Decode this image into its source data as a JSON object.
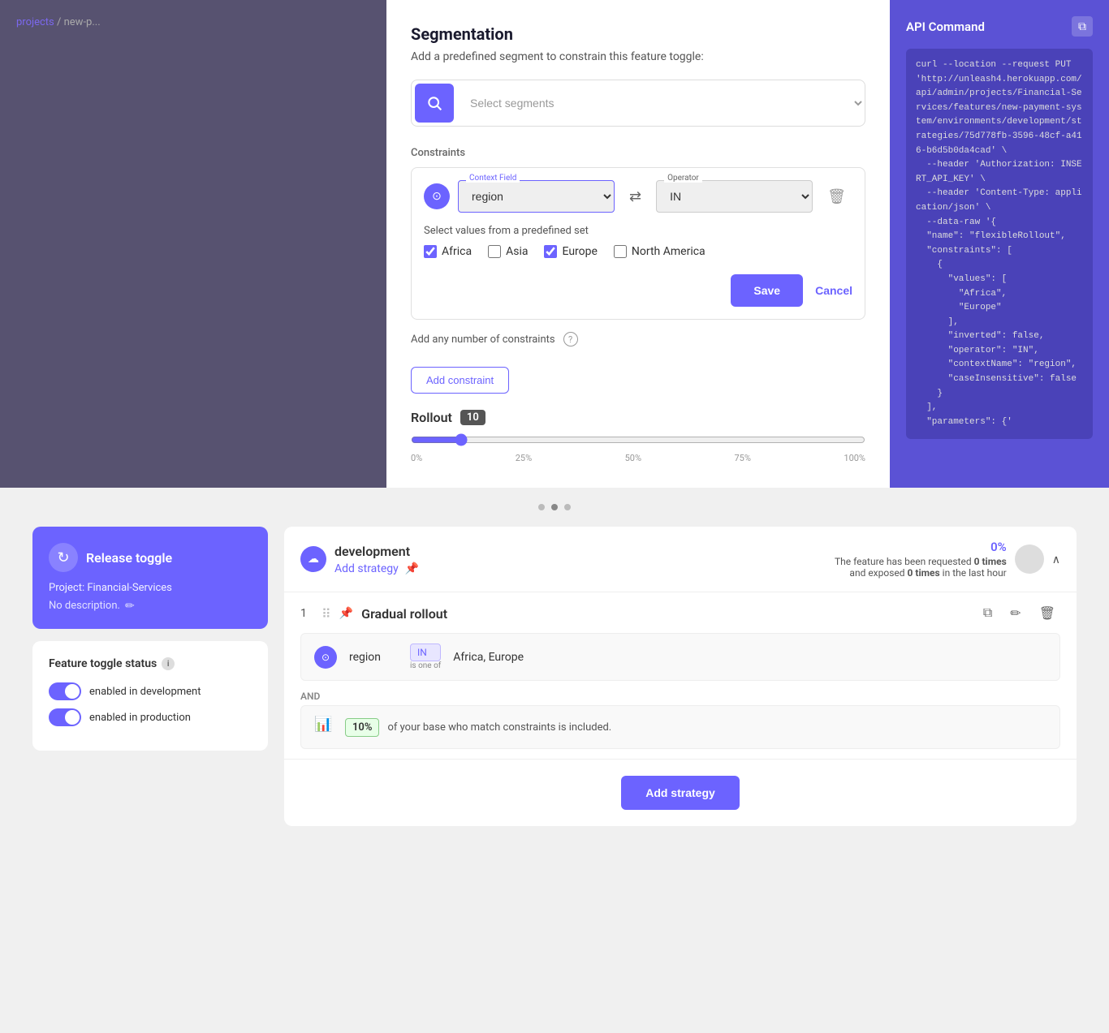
{
  "modal": {
    "title": "Segmentation",
    "subtitle": "Add a predefined segment to constrain this feature toggle:",
    "segment_placeholder": "Select segments",
    "constraints_label": "Constraints",
    "constraint": {
      "context_field_label": "Context Field",
      "context_field_value": "region",
      "invert_symbol": "⇄",
      "operator_label": "Operator",
      "operator_value": "IN",
      "operator_subtext": "Is one of",
      "predefined_label": "Select values from a predefined set",
      "checkboxes": [
        {
          "label": "Africa",
          "checked": true
        },
        {
          "label": "Asia",
          "checked": false
        },
        {
          "label": "Europe",
          "checked": true
        },
        {
          "label": "North America",
          "checked": false
        }
      ],
      "save_label": "Save",
      "cancel_label": "Cancel"
    },
    "add_constraints_label": "Add any number of constraints",
    "add_constraint_btn": "Add constraint",
    "rollout_label": "Rollout",
    "rollout_value": "10",
    "slider_labels": [
      "0%",
      "25%",
      "50%",
      "75%",
      "100%"
    ]
  },
  "api_panel": {
    "title": "API Command",
    "copy_icon": "⧉",
    "code": "curl --location --request PUT 'http://unleash4.herokuapp.com/api/admin/projects/Financial-Services/features/new-payment-system/environments/development/strategies/75d778fb-3596-48cf-a416-b6d5b0da4cad' \\\n  --header 'Authorization: INSERT_API_KEY' \\\n  --header 'Content-Type: application/json' \\\n  --data-raw '{\n  \"name\": \"flexibleRollout\",\n  \"constraints\": [\n    {\n      \"values\": [\n        \"Africa\",\n        \"Europe\"\n      ],\n      \"inverted\": false,\n      \"operator\": \"IN\",\n      \"contextName\": \"region\",\n      \"caseInsensitive\": false\n    }\n  ],\n  \"parameters\": {'"
  },
  "bottom": {
    "dots": 3,
    "release_card": {
      "icon": "↻",
      "title": "Release toggle",
      "project_label": "Project: Financial-Services",
      "desc_label": "No description."
    },
    "toggle_status": {
      "title": "Feature toggle status",
      "dev_label": "enabled in development",
      "prod_label": "enabled in production"
    },
    "environment": {
      "name": "development",
      "add_strategy_label": "Add strategy",
      "percent": "0%",
      "stats_line1": "The feature has been requested",
      "requests_bold": "0 times",
      "stats_line2": "and exposed",
      "exposed_bold": "0 times",
      "stats_line3": "in the last hour"
    },
    "strategy": {
      "num": "1",
      "name": "Gradual rollout",
      "constraint_field": "region",
      "constraint_op": "IN",
      "constraint_op_sub": "is one of",
      "constraint_values": "Africa, Europe",
      "rollout_pct": "10%",
      "rollout_text": "of your base who match constraints is included.",
      "add_strategy_btn": "Add strategy"
    }
  },
  "breadcrumb": {
    "projects": "projects",
    "separator": "/",
    "feature": "new-p..."
  },
  "feature_title": "new-p..."
}
